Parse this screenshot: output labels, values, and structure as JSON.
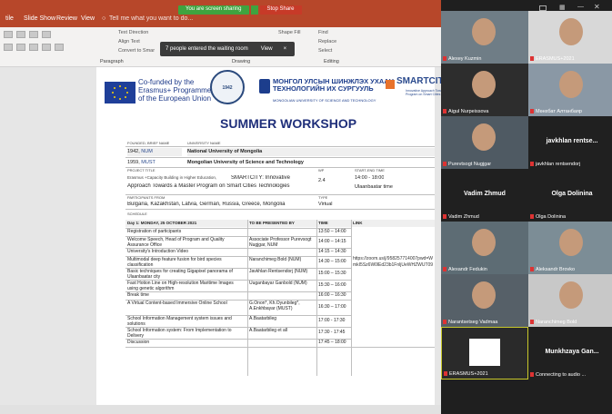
{
  "menubar": {
    "items": [
      "tile",
      "Slide Show",
      "Review",
      "View"
    ],
    "tell_me": "Tell me what you want to do..."
  },
  "sharing": {
    "status": "You are screen sharing",
    "stop_label": "Stop Share"
  },
  "ribbon": {
    "text_direction": "Text Direction",
    "align_text": "Align Text",
    "convert": "Convert to Smar",
    "paragraph_label": "Paragraph",
    "drawing_label": "Drawing",
    "shape_fill": "Shape Fill",
    "find": "Find",
    "replace": "Replace",
    "select": "Select",
    "editing_label": "Editing"
  },
  "toast": {
    "message": "7 people entered the waiting room",
    "view_label": "View",
    "close": "×"
  },
  "slide": {
    "cofund_line1": "Co-funded by the",
    "cofund_line2": "Erasmus+ Programme",
    "cofund_line3": "of the European Union",
    "num_seal_year": "1942",
    "must_line1": "МОНГОЛ УЛСЫН ШИНЖЛЭХ УХААН",
    "must_line2": "ТЕХНОЛОГИЙН ИХ СУРГУУЛЬ",
    "must_sub": "MONGOLIAN UNIVERSITY OF SCIENCE AND TECHNOLOGY",
    "smartcity": "SMARTCITY",
    "smartcity_sub1": "Innovative Approach Towards a Master",
    "smartcity_sub2": "Program on Smart Cities Technologies",
    "title": "SUMMER WORKSHOP"
  },
  "header_table": {
    "founded_hdr": "FOUNDED, BRIEF NAME",
    "university_hdr": "UNIVERSITY NAME",
    "num_year": "1942,",
    "num_short": "NUM",
    "num_name": "National University of Mongolia",
    "must_year": "1959,",
    "must_short": "MUST",
    "must_name": "Mongolian University of Science and Technology",
    "project_title_hdr": "PROJECT TITLE",
    "wp_hdr": "WP",
    "start_end_hdr": "START-END TIME",
    "project_title_small": "Erasmus +Capacity Building in Higher Education, ",
    "project_title_big1": "SMARTCITY: Innovative",
    "project_title_big2": "Approach Towards a Master Program on Smart Cities Technologies",
    "wp_value": "2.4",
    "time_value": "14:00 - 18:00",
    "time_zone": "Ulaanbaatar time",
    "participants_hdr": "PARTICIPANTS FROM",
    "type_hdr": "TYPE",
    "participants": "Bulgaria, Kazakhstan, Latvia, German, Russia, Greece, Mongolia",
    "type_value": "Virtual",
    "schedule_hdr": "SCHEDULE"
  },
  "schedule": {
    "day_hdr": "Day 1: MONDAY, 25 OCTOBER 2021",
    "presenter_hdr": "TO BE PRESENTED BY",
    "time_hdr": "TIME",
    "link_hdr": "LINK",
    "link_text": "https://zoom.us/j/958257714007pwd=WmkI5Sz6W0lEd23b1FnljUeWHZWUT09",
    "rows": [
      {
        "topic": "Registration of participants",
        "presenter": "",
        "time": "13:50 – 14:00"
      },
      {
        "topic": "Welcome Speech, Head of Program and Quality Assurance Office",
        "presenter": "Associate Professor Purevsogt Nugjgar, NUM",
        "time": "14:00 – 14:15"
      },
      {
        "topic": "University's Introduction Video",
        "presenter": "",
        "time": "14:15 – 14:30"
      },
      {
        "topic": "Multimodal deep feature fusion for bird species classification",
        "presenter": "Naranchimeg Bold (NUM)",
        "time": "14:30 – 15:00"
      },
      {
        "topic": "Basic techniques for creating Gigapixel panorama of Ulaanbaatar city",
        "presenter": "Javkhlan Rentsendorj (NUM)",
        "time": "15:00 – 15:30"
      },
      {
        "topic": "Fast Hotion Line on High-resolution Maritime Images using genetic algorithm",
        "presenter": "Uuganbayar Ganbold (NUM)",
        "time": "15:30 – 16:00"
      },
      {
        "topic": "Break time",
        "presenter": "",
        "time": "16:00 – 16:30"
      },
      {
        "topic": "A Virtual Content-based Immersive Online School",
        "presenter": "G.Onon*, Kh.Oyunbileg*, A.Enkhbayar (MUST)",
        "time": "16:30 – 17:00"
      },
      {
        "topic": "School Information Management system issues and solutions",
        "presenter": "A.Baatarbileg",
        "time": "17:00 - 17:30"
      },
      {
        "topic": "School Information system: From Implementation to Delivery",
        "presenter": "A.Baatarbileg et all",
        "time": "17:30 - 17:45"
      },
      {
        "topic": "Discussion",
        "presenter": "",
        "time": "17:45 – 18:00"
      }
    ]
  },
  "participants_panel": {
    "tiles": [
      {
        "name": "Alexey Kuzmin",
        "big": ""
      },
      {
        "name": "ERASMUS+2021",
        "big": ""
      },
      {
        "name": "Aigul Nurpeissova",
        "big": ""
      },
      {
        "name": "Мөнхбат Алтанбаяр",
        "big": ""
      },
      {
        "name": "Purevtsogt Nugjgar",
        "big": ""
      },
      {
        "name": "javkhlan rentsendorj",
        "big": "javkhlan rentse..."
      },
      {
        "name": "Vadim Zhmud",
        "big": "Vadim Zhmud"
      },
      {
        "name": "Olga Dolinina",
        "big": "Olga Dolinina"
      },
      {
        "name": "Alexandr Fedukin",
        "big": ""
      },
      {
        "name": "Aleksandr Brovko",
        "big": ""
      },
      {
        "name": "Narantsetseg Vadmaa",
        "big": ""
      },
      {
        "name": "Naranchimeg Bold",
        "big": ""
      },
      {
        "name": "ERASMUS+2021",
        "big": ""
      },
      {
        "name": "Connecting to audio ...",
        "big": "Munkhzaya Gan..."
      }
    ]
  },
  "colors": {
    "ribbon_red": "#b7472a",
    "share_green": "#3fa33f",
    "stop_red": "#c73a28",
    "panel_bg": "#1f1f1f",
    "title_navy": "#1f2f7a"
  }
}
